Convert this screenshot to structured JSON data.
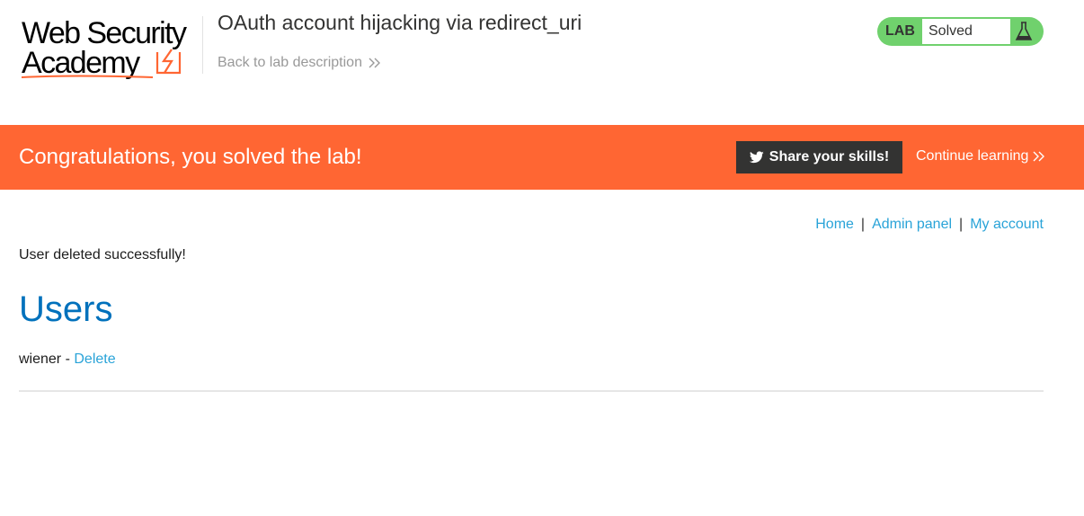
{
  "header": {
    "logo_line1": "Web Security",
    "logo_line2": "Academy",
    "lab_title": "OAuth account hijacking via redirect_uri",
    "back_link": "Back to lab description",
    "lab_tag": "LAB",
    "lab_status": "Solved",
    "status_color": "#70d16d"
  },
  "banner": {
    "message": "Congratulations, you solved the lab!",
    "share_label": "Share your skills!",
    "continue_label": "Continue learning",
    "color": "#ff6633"
  },
  "nav": {
    "home": "Home",
    "separator": "|",
    "admin": "Admin panel",
    "account": "My account"
  },
  "main": {
    "message": "User deleted successfully!",
    "heading": "Users",
    "users": [
      {
        "name": "wiener",
        "separator": " - ",
        "action": "Delete"
      }
    ]
  },
  "icons": {
    "logo_mark": "lightning-bolt-icon",
    "status": "flask-icon",
    "share": "twitter-bird-icon",
    "continue": "double-chevron-right-icon"
  },
  "colors": {
    "link": "#29a3d8",
    "heading": "#0071bc",
    "accent": "#ff6633",
    "dark": "#333332"
  }
}
